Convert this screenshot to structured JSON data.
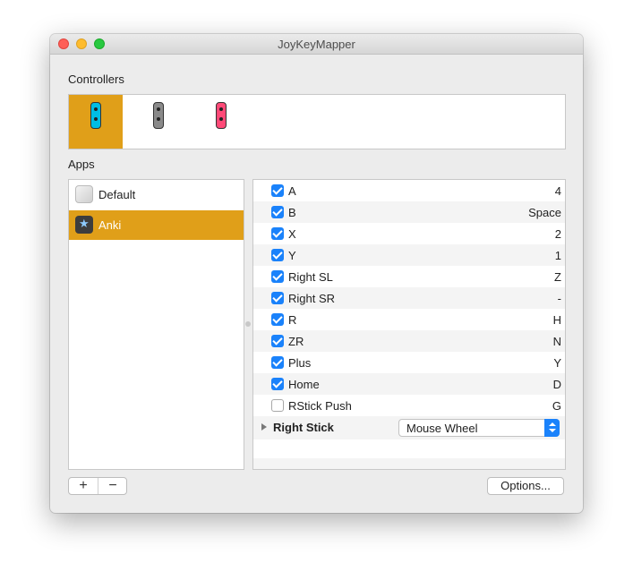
{
  "window": {
    "title": "JoyKeyMapper"
  },
  "controllers": {
    "label": "Controllers",
    "items": [
      {
        "name": "joycon-right-icon",
        "color": "#00bde4",
        "selected": true
      },
      {
        "name": "joycon-gray-icon",
        "color": "#8a8a8a",
        "selected": false
      },
      {
        "name": "joycon-pink-icon",
        "color": "#ff4a78",
        "selected": false
      }
    ]
  },
  "apps": {
    "label": "Apps",
    "items": [
      {
        "label": "Default",
        "icon": "default-app-icon",
        "selected": false
      },
      {
        "label": "Anki",
        "icon": "anki-app-icon",
        "selected": true
      }
    ]
  },
  "mappings": [
    {
      "button": "A",
      "key": "4",
      "enabled": true
    },
    {
      "button": "B",
      "key": "Space",
      "enabled": true
    },
    {
      "button": "X",
      "key": "2",
      "enabled": true
    },
    {
      "button": "Y",
      "key": "1",
      "enabled": true
    },
    {
      "button": "Right SL",
      "key": "Z",
      "enabled": true
    },
    {
      "button": "Right SR",
      "key": "-",
      "enabled": true
    },
    {
      "button": "R",
      "key": "H",
      "enabled": true
    },
    {
      "button": "ZR",
      "key": "N",
      "enabled": true
    },
    {
      "button": "Plus",
      "key": "Y",
      "enabled": true
    },
    {
      "button": "Home",
      "key": "D",
      "enabled": true
    },
    {
      "button": "RStick Push",
      "key": "G",
      "enabled": false
    }
  ],
  "stick": {
    "label": "Right Stick",
    "mode": "Mouse Wheel"
  },
  "footer": {
    "add_label": "+",
    "remove_label": "−",
    "options_label": "Options..."
  },
  "colors": {
    "accent": "#e09f19",
    "checkbox": "#1a82fb"
  }
}
